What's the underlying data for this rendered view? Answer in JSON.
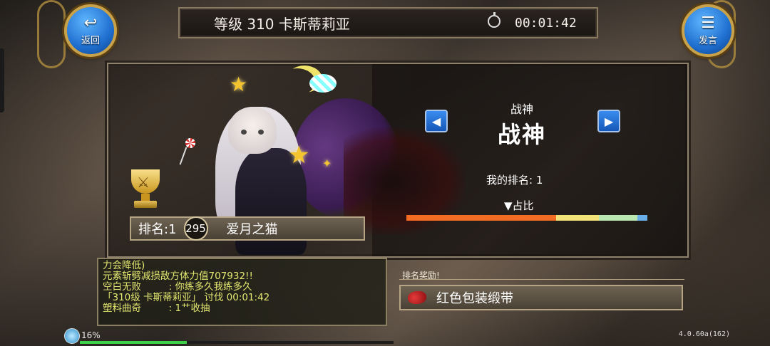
{
  "top_left_button": {
    "label": "返回",
    "icon": "back-arrow-icon"
  },
  "top_right_button": {
    "label": "发言",
    "icon": "chat-bubble-icon"
  },
  "header": {
    "level_name": "等级 310 卡斯蒂莉亚",
    "timer_icon": "stopwatch-icon",
    "time": "00:01:42"
  },
  "ranking": {
    "rank_label": "排名:1",
    "player_level": "295",
    "player_name": "爱月之猫"
  },
  "title_selector": {
    "title_small": "战神",
    "title_big": "战神",
    "prev_icon": "left-arrow-icon",
    "next_icon": "right-arrow-icon",
    "my_rank": "我的排名: 1",
    "share_label": "▼占比",
    "share_segments": [
      {
        "fraction": 0.62,
        "color": "#f36c24"
      },
      {
        "fraction": 0.18,
        "color": "#f3e27a"
      },
      {
        "fraction": 0.16,
        "color": "#b8e8b0"
      },
      {
        "fraction": 0.04,
        "color": "#6aaee8"
      }
    ]
  },
  "chat_log": [
    "力会降低)",
    "元素斩劈减损敌方体力值707932!!",
    "空白无败         : 你练多久我练多久",
    "「310级 卡斯蒂莉亚」 讨伐 00:01:42",
    "塑料曲奇         : 1艹收抽"
  ],
  "reward": {
    "header": "排名奖励!",
    "item_name": "红色包装缎带",
    "item_icon": "red-ribbon-icon"
  },
  "status": {
    "percent": "16%",
    "xp_fraction": 0.34,
    "version": "4.0.60a(162)"
  }
}
